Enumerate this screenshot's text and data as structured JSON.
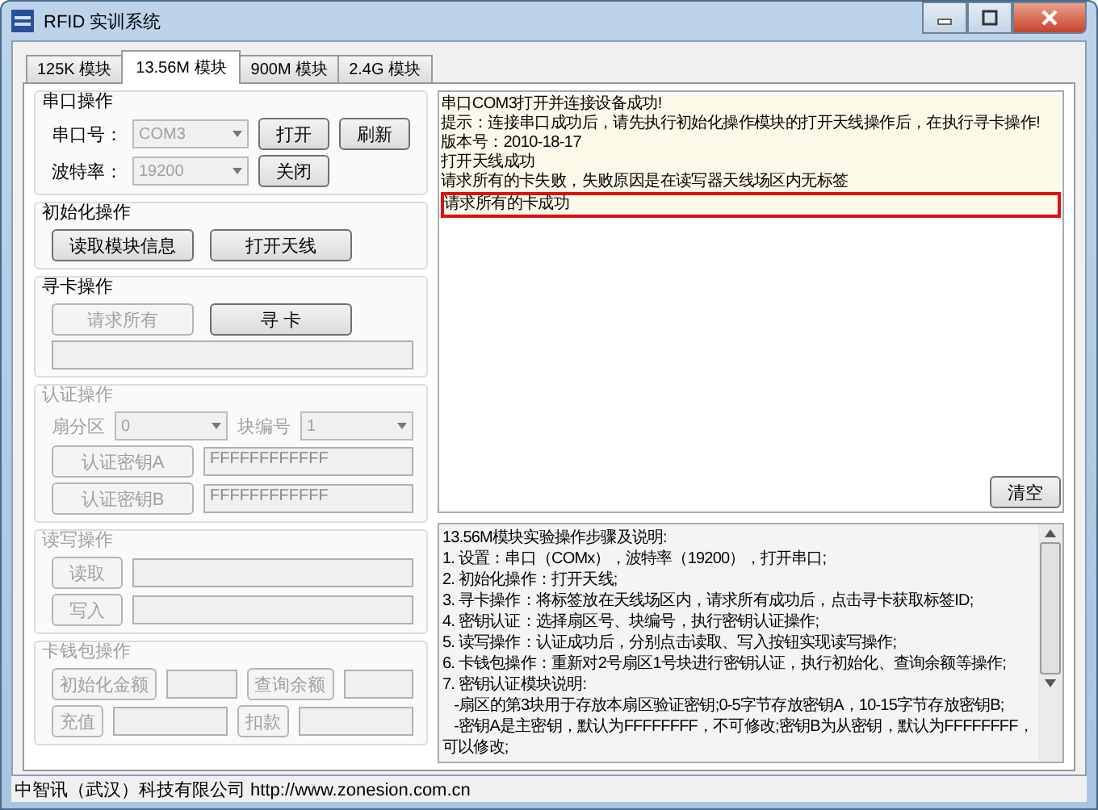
{
  "window": {
    "title": "RFID 实训系统"
  },
  "tabs": [
    {
      "label": "125K 模块",
      "selected": false
    },
    {
      "label": "13.56M 模块",
      "selected": true
    },
    {
      "label": "900M 模块",
      "selected": false
    },
    {
      "label": "2.4G 模块",
      "selected": false
    }
  ],
  "groups": [
    {
      "title": "串口操作",
      "disabled": false,
      "rows": [
        [
          {
            "kind": "label",
            "text": "串口号："
          },
          {
            "kind": "combo",
            "value": "COM3",
            "disabled": true
          },
          {
            "kind": "button",
            "label": "打开",
            "disabled": false
          },
          {
            "kind": "button",
            "label": "刷新",
            "disabled": false
          }
        ],
        [
          {
            "kind": "label",
            "text": "波特率："
          },
          {
            "kind": "combo",
            "value": "19200",
            "disabled": true
          },
          {
            "kind": "button",
            "label": "关闭",
            "disabled": false
          }
        ]
      ]
    },
    {
      "title": "初始化操作",
      "disabled": false,
      "rows": [
        [
          {
            "kind": "button",
            "label": "读取模块信息",
            "disabled": false
          },
          {
            "kind": "button",
            "label": "打开天线",
            "disabled": false
          }
        ]
      ]
    },
    {
      "title": "寻卡操作",
      "disabled": false,
      "rows": [
        [
          {
            "kind": "button",
            "label": "请求所有",
            "disabled": true
          },
          {
            "kind": "button",
            "label": "寻 卡",
            "disabled": false
          }
        ],
        [
          {
            "kind": "field",
            "disabled": true
          }
        ]
      ]
    },
    {
      "title": "认证操作",
      "disabled": true,
      "selectors": [
        {
          "kind": "label",
          "text": "扇分区"
        },
        {
          "kind": "combo",
          "value": "0",
          "disabled": true
        },
        {
          "kind": "label",
          "text": "块编号"
        },
        {
          "kind": "combo",
          "value": "1",
          "disabled": true
        }
      ],
      "rows": [
        [
          {
            "kind": "button",
            "label": "认证密钥A",
            "disabled": true
          },
          {
            "kind": "field",
            "value": "FFFFFFFFFFFF",
            "disabled": true
          }
        ],
        [
          {
            "kind": "button",
            "label": "认证密钥B",
            "disabled": true
          },
          {
            "kind": "field",
            "value": "FFFFFFFFFFFF",
            "disabled": true
          }
        ]
      ]
    },
    {
      "title": "读写操作",
      "disabled": true,
      "rows": [
        [
          {
            "kind": "button",
            "label": "读取",
            "disabled": true
          },
          {
            "kind": "field",
            "disabled": true
          }
        ],
        [
          {
            "kind": "button",
            "label": "写入",
            "disabled": true
          },
          {
            "kind": "field",
            "disabled": true
          }
        ]
      ]
    },
    {
      "title": "卡钱包操作",
      "disabled": true,
      "rows": [
        [
          {
            "kind": "button",
            "label": "初始化金额",
            "disabled": true
          },
          {
            "kind": "field",
            "disabled": true
          },
          {
            "kind": "button",
            "label": "查询余额",
            "disabled": true
          },
          {
            "kind": "field",
            "disabled": true
          }
        ],
        [
          {
            "kind": "button",
            "label": "充值",
            "disabled": true
          },
          {
            "kind": "field",
            "disabled": true
          },
          {
            "kind": "button",
            "label": "扣款",
            "disabled": true
          },
          {
            "kind": "field",
            "disabled": true
          }
        ]
      ]
    }
  ],
  "log": {
    "lines": [
      {
        "text": "串口COM3打开并连接设备成功!",
        "highlighted": false
      },
      {
        "text": "提示：连接串口成功后，请先执行初始化操作模块的打开天线操作后，在执行寻卡操作!",
        "highlighted": false
      },
      {
        "text": "版本号：2010-18-17",
        "highlighted": false
      },
      {
        "text": "打开天线成功",
        "highlighted": false
      },
      {
        "text": "请求所有的卡失败，失败原因是在读写器天线场区内无标签",
        "highlighted": false
      },
      {
        "text": "请求所有的卡成功",
        "highlighted": true
      }
    ],
    "clear_button": "清空"
  },
  "instructions": [
    "13.56M模块实验操作步骤及说明:",
    "1. 设置：串口（COMx），波特率（19200），打开串口;",
    "2. 初始化操作：打开天线;",
    "3. 寻卡操作：将标签放在天线场区内，请求所有成功后，点击寻卡获取标签ID;",
    "4. 密钥认证：选择扇区号、块编号，执行密钥认证操作;",
    "5. 读写操作：认证成功后，分别点击读取、写入按钮实现读写操作;",
    "6. 卡钱包操作：重新对2号扇区1号块进行密钥认证，执行初始化、查询余额等操作;",
    "7. 密钥认证模块说明:",
    "   -扇区的第3块用于存放本扇区验证密钥;0-5字节存放密钥A，10-15字节存放密钥B;",
    "   -密钥A是主密钥，默认为FFFFFFFF，不可修改;密钥B为从密钥，默认为FFFFFFFF，可以修改;"
  ],
  "status_bar": "中智讯（武汉）科技有限公司 http://www.zonesion.com.cn"
}
